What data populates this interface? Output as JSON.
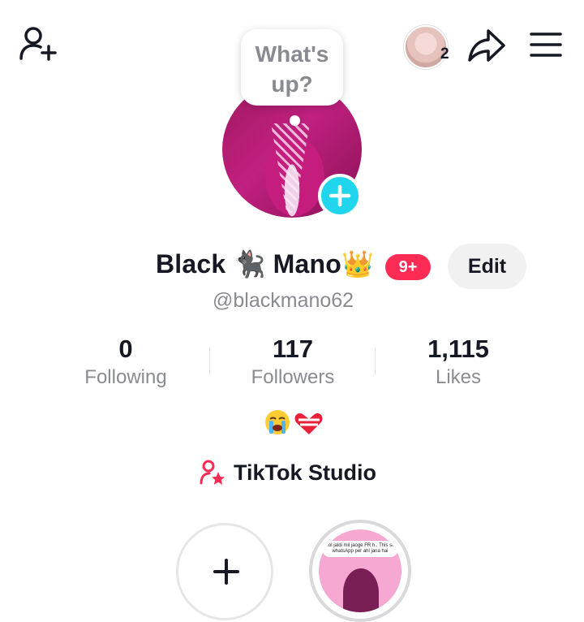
{
  "header": {
    "viewer_count": "2",
    "icons": {
      "add_friend": "person-plus-icon",
      "share": "share-arrow-icon",
      "menu": "hamburger-menu-icon"
    }
  },
  "avatar": {
    "bubble_text": "What's up?",
    "add_icon": "plus-icon"
  },
  "profile": {
    "display_name": "Black 🐈‍⬛ Mano👑",
    "notification_badge": "9+",
    "edit_label": "Edit",
    "username": "@blackmano62",
    "bio": "😭❤️‍🩹"
  },
  "stats": [
    {
      "value": "0",
      "label": "Following"
    },
    {
      "value": "117",
      "label": "Followers"
    },
    {
      "value": "1,115",
      "label": "Likes"
    }
  ],
  "studio": {
    "label": "TikTok Studio",
    "icon": "creator-star-icon"
  },
  "stories": {
    "add_icon": "plus-icon",
    "item_text": "..ol jaldi mil jaoge FR h.. This se whatsApp per ahl jana hai"
  },
  "colors": {
    "accent": "#fe2c55",
    "avatar_add": "#20d5ec",
    "muted_text": "#8a8b91"
  }
}
